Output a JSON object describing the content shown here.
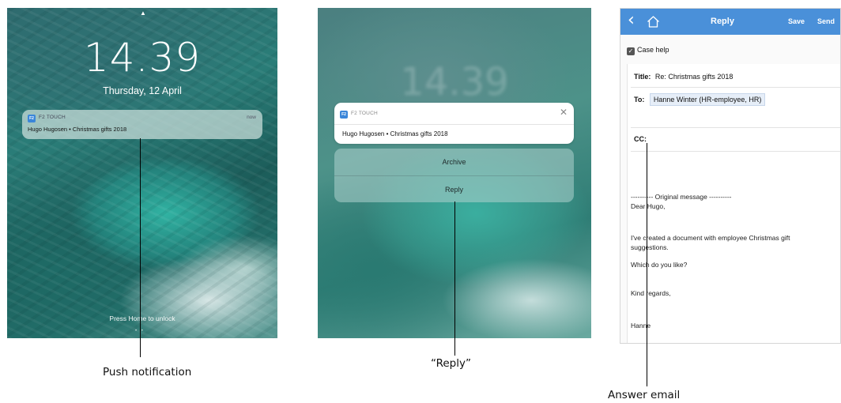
{
  "lockscreen": {
    "time": "14.39",
    "date": "Thursday, 12 April",
    "notification": {
      "app_icon": "F2",
      "app_name": "F2 TOUCH",
      "time": "now",
      "body": "Hugo Hugosen • Christmas gifts 2018"
    },
    "press_home": "Press Home to unlock"
  },
  "actions_screen": {
    "blurred_time": "14.39",
    "notification": {
      "app_icon": "F2",
      "app_name": "F2 TOUCH",
      "close": "✕",
      "body": "Hugo Hugosen • Christmas gifts 2018"
    },
    "actions": [
      "Archive",
      "Reply"
    ]
  },
  "reply_screen": {
    "nav": {
      "title": "Reply",
      "save": "Save",
      "send": "Send",
      "back_icon": "chevron-left-icon",
      "home_icon": "home-icon",
      "accent": "#4a90d9"
    },
    "case_help": "Case help",
    "title_label": "Title:",
    "title_value": "Re: Christmas gifts 2018",
    "to_label": "To:",
    "to_value": "Hanne Winter (HR-employee, HR)",
    "cc_label": "CC:",
    "body_lines": [
      "---------- Original message ----------",
      "Dear Hugo,",
      "I've created a document with employee Christmas gift",
      "suggestions.",
      "Which do you like?",
      "Kind regards,",
      "Hanne"
    ]
  },
  "captions": {
    "push": "Push notification",
    "reply": "“Reply”",
    "answer": "Answer email"
  }
}
